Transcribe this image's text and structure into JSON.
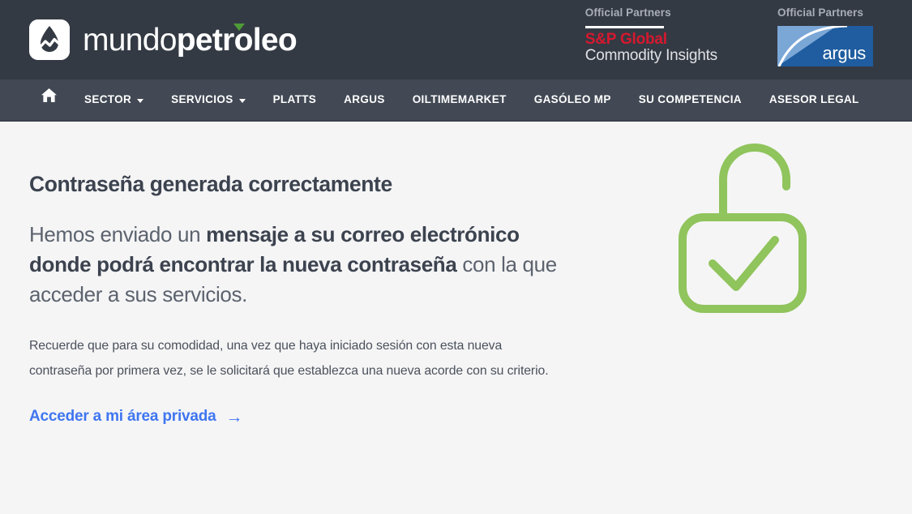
{
  "brand": {
    "mark_icon": "oil-drop-chart-icon",
    "name_light": "mundo",
    "name_bold": "petroleo",
    "accent_icon": "green-triangle-accent"
  },
  "header": {
    "partners": [
      {
        "caption": "Official Partners",
        "logo": "sp-global-commodity-insights-logo",
        "name": "S&P Global",
        "subtitle": "Commodity Insights",
        "name_color": "#d6182e"
      },
      {
        "caption": "Official Partners",
        "logo": "argus-logo",
        "name": "argus",
        "bg_color": "#1f5da0",
        "accent_color": "#7ba7d7"
      }
    ]
  },
  "nav": {
    "home_icon": "home-icon",
    "items": [
      {
        "label": "SECTOR",
        "has_dropdown": true
      },
      {
        "label": "SERVICIOS",
        "has_dropdown": true
      },
      {
        "label": "PLATTS",
        "has_dropdown": false
      },
      {
        "label": "ARGUS",
        "has_dropdown": false
      },
      {
        "label": "OILTIMEMARKET",
        "has_dropdown": false
      },
      {
        "label": "GASÓLEO MP",
        "has_dropdown": false
      },
      {
        "label": "SU COMPETENCIA",
        "has_dropdown": false
      },
      {
        "label": "ASESOR LEGAL",
        "has_dropdown": false
      }
    ]
  },
  "main": {
    "title": "Contraseña generada correctamente",
    "lead": {
      "part1": "Hemos enviado un ",
      "strong": "mensaje a su correo electrónico donde podrá encontrar la nueva contraseña",
      "part2": " con la que acceder a sus servicios."
    },
    "note": "Recuerde que para su comodidad, una vez que haya iniciado sesión con esta nueva contraseña por primera vez, se le solicitará que establezca una nueva acorde con su criterio.",
    "cta": {
      "label": "Acceder a mi área privada",
      "arrow": "→",
      "color": "#3f76f0"
    },
    "illustration": {
      "icon": "unlocked-padlock-check-icon",
      "color": "#90c45c"
    }
  }
}
